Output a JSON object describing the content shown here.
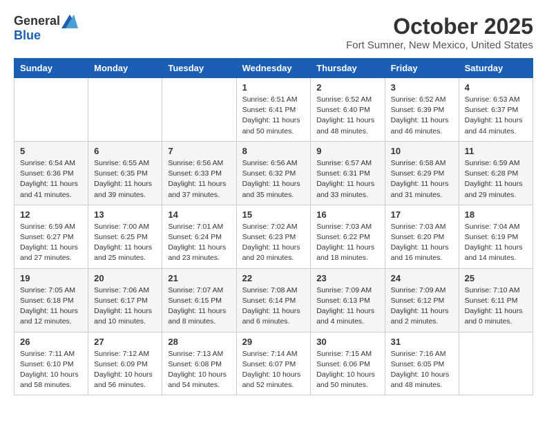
{
  "header": {
    "logo_general": "General",
    "logo_blue": "Blue",
    "title": "October 2025",
    "location": "Fort Sumner, New Mexico, United States"
  },
  "weekdays": [
    "Sunday",
    "Monday",
    "Tuesday",
    "Wednesday",
    "Thursday",
    "Friday",
    "Saturday"
  ],
  "weeks": [
    [
      {
        "day": "",
        "info": ""
      },
      {
        "day": "",
        "info": ""
      },
      {
        "day": "",
        "info": ""
      },
      {
        "day": "1",
        "info": "Sunrise: 6:51 AM\nSunset: 6:41 PM\nDaylight: 11 hours\nand 50 minutes."
      },
      {
        "day": "2",
        "info": "Sunrise: 6:52 AM\nSunset: 6:40 PM\nDaylight: 11 hours\nand 48 minutes."
      },
      {
        "day": "3",
        "info": "Sunrise: 6:52 AM\nSunset: 6:39 PM\nDaylight: 11 hours\nand 46 minutes."
      },
      {
        "day": "4",
        "info": "Sunrise: 6:53 AM\nSunset: 6:37 PM\nDaylight: 11 hours\nand 44 minutes."
      }
    ],
    [
      {
        "day": "5",
        "info": "Sunrise: 6:54 AM\nSunset: 6:36 PM\nDaylight: 11 hours\nand 41 minutes."
      },
      {
        "day": "6",
        "info": "Sunrise: 6:55 AM\nSunset: 6:35 PM\nDaylight: 11 hours\nand 39 minutes."
      },
      {
        "day": "7",
        "info": "Sunrise: 6:56 AM\nSunset: 6:33 PM\nDaylight: 11 hours\nand 37 minutes."
      },
      {
        "day": "8",
        "info": "Sunrise: 6:56 AM\nSunset: 6:32 PM\nDaylight: 11 hours\nand 35 minutes."
      },
      {
        "day": "9",
        "info": "Sunrise: 6:57 AM\nSunset: 6:31 PM\nDaylight: 11 hours\nand 33 minutes."
      },
      {
        "day": "10",
        "info": "Sunrise: 6:58 AM\nSunset: 6:29 PM\nDaylight: 11 hours\nand 31 minutes."
      },
      {
        "day": "11",
        "info": "Sunrise: 6:59 AM\nSunset: 6:28 PM\nDaylight: 11 hours\nand 29 minutes."
      }
    ],
    [
      {
        "day": "12",
        "info": "Sunrise: 6:59 AM\nSunset: 6:27 PM\nDaylight: 11 hours\nand 27 minutes."
      },
      {
        "day": "13",
        "info": "Sunrise: 7:00 AM\nSunset: 6:25 PM\nDaylight: 11 hours\nand 25 minutes."
      },
      {
        "day": "14",
        "info": "Sunrise: 7:01 AM\nSunset: 6:24 PM\nDaylight: 11 hours\nand 23 minutes."
      },
      {
        "day": "15",
        "info": "Sunrise: 7:02 AM\nSunset: 6:23 PM\nDaylight: 11 hours\nand 20 minutes."
      },
      {
        "day": "16",
        "info": "Sunrise: 7:03 AM\nSunset: 6:22 PM\nDaylight: 11 hours\nand 18 minutes."
      },
      {
        "day": "17",
        "info": "Sunrise: 7:03 AM\nSunset: 6:20 PM\nDaylight: 11 hours\nand 16 minutes."
      },
      {
        "day": "18",
        "info": "Sunrise: 7:04 AM\nSunset: 6:19 PM\nDaylight: 11 hours\nand 14 minutes."
      }
    ],
    [
      {
        "day": "19",
        "info": "Sunrise: 7:05 AM\nSunset: 6:18 PM\nDaylight: 11 hours\nand 12 minutes."
      },
      {
        "day": "20",
        "info": "Sunrise: 7:06 AM\nSunset: 6:17 PM\nDaylight: 11 hours\nand 10 minutes."
      },
      {
        "day": "21",
        "info": "Sunrise: 7:07 AM\nSunset: 6:15 PM\nDaylight: 11 hours\nand 8 minutes."
      },
      {
        "day": "22",
        "info": "Sunrise: 7:08 AM\nSunset: 6:14 PM\nDaylight: 11 hours\nand 6 minutes."
      },
      {
        "day": "23",
        "info": "Sunrise: 7:09 AM\nSunset: 6:13 PM\nDaylight: 11 hours\nand 4 minutes."
      },
      {
        "day": "24",
        "info": "Sunrise: 7:09 AM\nSunset: 6:12 PM\nDaylight: 11 hours\nand 2 minutes."
      },
      {
        "day": "25",
        "info": "Sunrise: 7:10 AM\nSunset: 6:11 PM\nDaylight: 11 hours\nand 0 minutes."
      }
    ],
    [
      {
        "day": "26",
        "info": "Sunrise: 7:11 AM\nSunset: 6:10 PM\nDaylight: 10 hours\nand 58 minutes."
      },
      {
        "day": "27",
        "info": "Sunrise: 7:12 AM\nSunset: 6:09 PM\nDaylight: 10 hours\nand 56 minutes."
      },
      {
        "day": "28",
        "info": "Sunrise: 7:13 AM\nSunset: 6:08 PM\nDaylight: 10 hours\nand 54 minutes."
      },
      {
        "day": "29",
        "info": "Sunrise: 7:14 AM\nSunset: 6:07 PM\nDaylight: 10 hours\nand 52 minutes."
      },
      {
        "day": "30",
        "info": "Sunrise: 7:15 AM\nSunset: 6:06 PM\nDaylight: 10 hours\nand 50 minutes."
      },
      {
        "day": "31",
        "info": "Sunrise: 7:16 AM\nSunset: 6:05 PM\nDaylight: 10 hours\nand 48 minutes."
      },
      {
        "day": "",
        "info": ""
      }
    ]
  ]
}
